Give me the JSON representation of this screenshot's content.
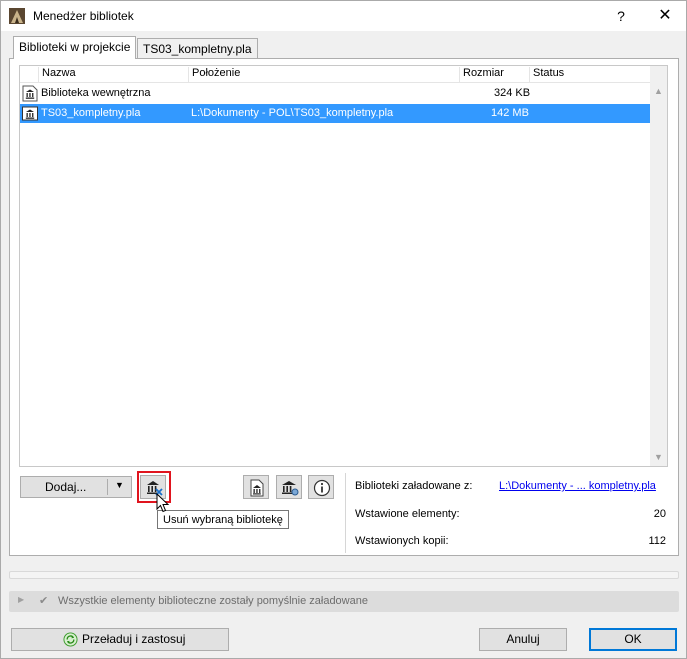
{
  "window": {
    "title": "Menedżer bibliotek",
    "help_glyph": "?",
    "close_glyph": "✕"
  },
  "tabs": [
    {
      "label": "Biblioteki w projekcie",
      "active": true
    },
    {
      "label": "TS03_kompletny.pla",
      "active": false
    }
  ],
  "table": {
    "columns": [
      "Nazwa",
      "Położenie",
      "Rozmiar",
      "Status"
    ],
    "rows": [
      {
        "icon": "library-icon",
        "name": "Biblioteka wewnętrzna",
        "location": "",
        "size": "324 KB",
        "status": "",
        "selected": false
      },
      {
        "icon": "library-file-icon",
        "name": "TS03_kompletny.pla",
        "location": "L:\\Dokumenty - POL\\TS03_kompletny.pla",
        "size": "142 MB",
        "status": "",
        "selected": true
      }
    ]
  },
  "toolbar": {
    "add_label": "Dodaj...",
    "tooltip": "Usuń wybraną bibliotekę"
  },
  "info": {
    "loaded_from_label": "Biblioteki załadowane z:",
    "loaded_from_value": "L:\\Dokumenty - ... kompletny.pla",
    "placed_elements_label": "Wstawione elementy:",
    "placed_elements_value": "20",
    "placed_copies_label": "Wstawionych kopii:",
    "placed_copies_value": "112"
  },
  "status": {
    "message": "Wszystkie elementy biblioteczne zostały pomyślnie załadowane"
  },
  "buttons": {
    "reload": "Przeładuj i zastosuj",
    "cancel": "Anuluj",
    "ok": "OK"
  },
  "colors": {
    "selection": "#3399ff",
    "highlight_border": "#e0141e",
    "link": "#0000ee",
    "ok_border": "#0078d7"
  }
}
